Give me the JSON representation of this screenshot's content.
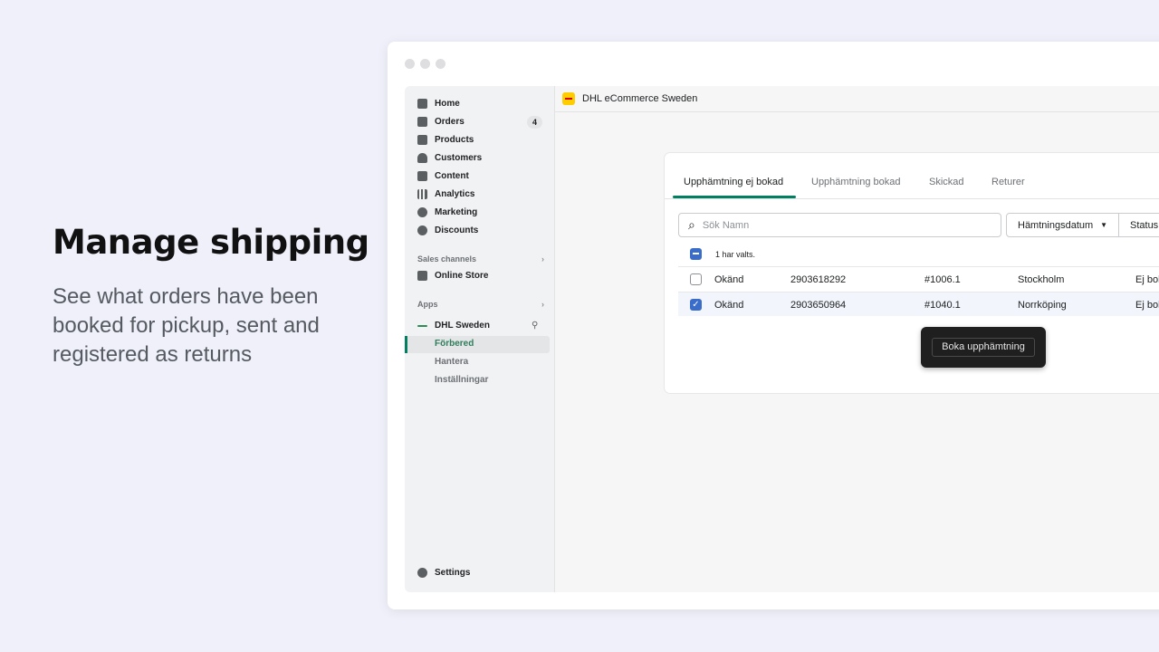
{
  "hero": {
    "title": "Manage shipping",
    "subtitle": "See what orders have been booked for pickup, sent and registered as returns"
  },
  "sidebar": {
    "items": [
      {
        "label": "Home",
        "icon": "home-icon"
      },
      {
        "label": "Orders",
        "icon": "orders-icon",
        "badge": "4"
      },
      {
        "label": "Products",
        "icon": "tag-icon"
      },
      {
        "label": "Customers",
        "icon": "person-icon"
      },
      {
        "label": "Content",
        "icon": "content-icon"
      },
      {
        "label": "Analytics",
        "icon": "bar-chart-icon"
      },
      {
        "label": "Marketing",
        "icon": "target-icon"
      },
      {
        "label": "Discounts",
        "icon": "discount-icon"
      }
    ],
    "sales_channels": "Sales channels",
    "online_store": "Online Store",
    "apps": "Apps",
    "app_name": "DHL Sweden",
    "app_sub": [
      "Förbered",
      "Hantera",
      "Inställningar"
    ],
    "settings": "Settings"
  },
  "topbar": {
    "title": "DHL eCommerce Sweden"
  },
  "tabs": [
    "Upphämtning ej bokad",
    "Upphämtning bokad",
    "Skickad",
    "Returer"
  ],
  "search": {
    "placeholder": "Sök Namn"
  },
  "filters": [
    "Hämtningsdatum",
    "Status"
  ],
  "selection": "1 har valts.",
  "rows": [
    {
      "name": "Okänd",
      "id": "2903618292",
      "order": "#1006.1",
      "city": "Stockholm",
      "status": "Ej bokad",
      "checked": false
    },
    {
      "name": "Okänd",
      "id": "2903650964",
      "order": "#1040.1",
      "city": "Norrköping",
      "status": "Ej bokad",
      "checked": true
    }
  ],
  "action": "Boka upphämtning",
  "colors": {
    "accent": "#008060",
    "checkbox": "#3a6cc9",
    "dhl_yellow": "#ffcc00"
  }
}
